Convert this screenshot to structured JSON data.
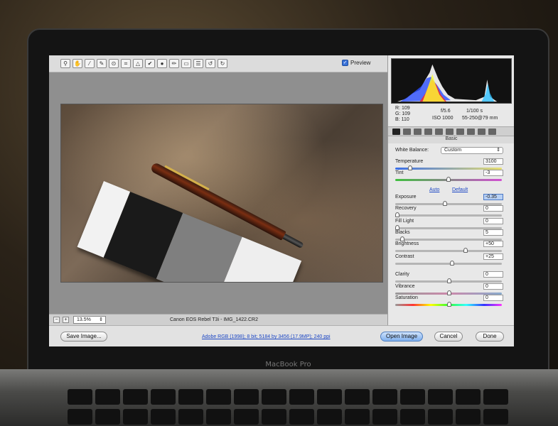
{
  "toolbar": {
    "tools": [
      "zoom-tool",
      "hand-tool",
      "white-balance-tool",
      "color-sampler-tool",
      "target-adjustment-tool",
      "crop-tool",
      "straighten-tool",
      "spot-removal-tool",
      "red-eye-tool",
      "adjustment-brush-tool",
      "graduated-filter-tool",
      "preferences",
      "rotate-left",
      "rotate-right"
    ],
    "preview_label": "Preview",
    "preview_checked": true
  },
  "status": {
    "zoom_value": "13.5%",
    "file_title": "Canon EOS Rebel T3i  -  IMG_1422.CR2"
  },
  "info": {
    "r_label": "R:",
    "r_value": "109",
    "g_label": "G:",
    "g_value": "109",
    "b_label": "B:",
    "b_value": "110",
    "aperture": "f/5.6",
    "shutter": "1/100 s",
    "iso": "ISO 1000",
    "focal": "55-250@79 mm"
  },
  "panel": {
    "title": "Basic",
    "white_balance_label": "White Balance:",
    "white_balance_value": "Custom",
    "auto_label": "Auto",
    "default_label": "Default",
    "adjustments": [
      {
        "name": "temperature",
        "label": "Temperature",
        "value": "3100",
        "level": 0.12
      },
      {
        "name": "tint",
        "label": "Tint",
        "value": "-3",
        "level": 0.49
      },
      {
        "name": "exposure",
        "label": "Exposure",
        "value": "-0.35",
        "level": 0.46
      },
      {
        "name": "recovery",
        "label": "Recovery",
        "value": "0",
        "level": 0.0
      },
      {
        "name": "fill-light",
        "label": "Fill Light",
        "value": "0",
        "level": 0.0
      },
      {
        "name": "blacks",
        "label": "Blacks",
        "value": "5",
        "level": 0.05
      },
      {
        "name": "brightness",
        "label": "Brightness",
        "value": "+50",
        "level": 0.66
      },
      {
        "name": "contrast",
        "label": "Contrast",
        "value": "+25",
        "level": 0.53
      },
      {
        "name": "clarity",
        "label": "Clarity",
        "value": "0",
        "level": 0.5
      },
      {
        "name": "vibrance",
        "label": "Vibrance",
        "value": "0",
        "level": 0.5
      },
      {
        "name": "saturation",
        "label": "Saturation",
        "value": "0",
        "level": 0.5
      }
    ]
  },
  "bottom": {
    "save_label": "Save Image...",
    "workflow_label": "Adobe RGB (1998); 8 bit; 5184 by 3456 (17.9MP); 240 ppi",
    "open_label": "Open Image",
    "cancel_label": "Cancel",
    "done_label": "Done"
  },
  "laptop": {
    "brand": "MacBook Pro"
  },
  "colors": {
    "accent": "#3a72d8",
    "link": "#1b46c4",
    "primary_button": "#7fb0ee"
  }
}
